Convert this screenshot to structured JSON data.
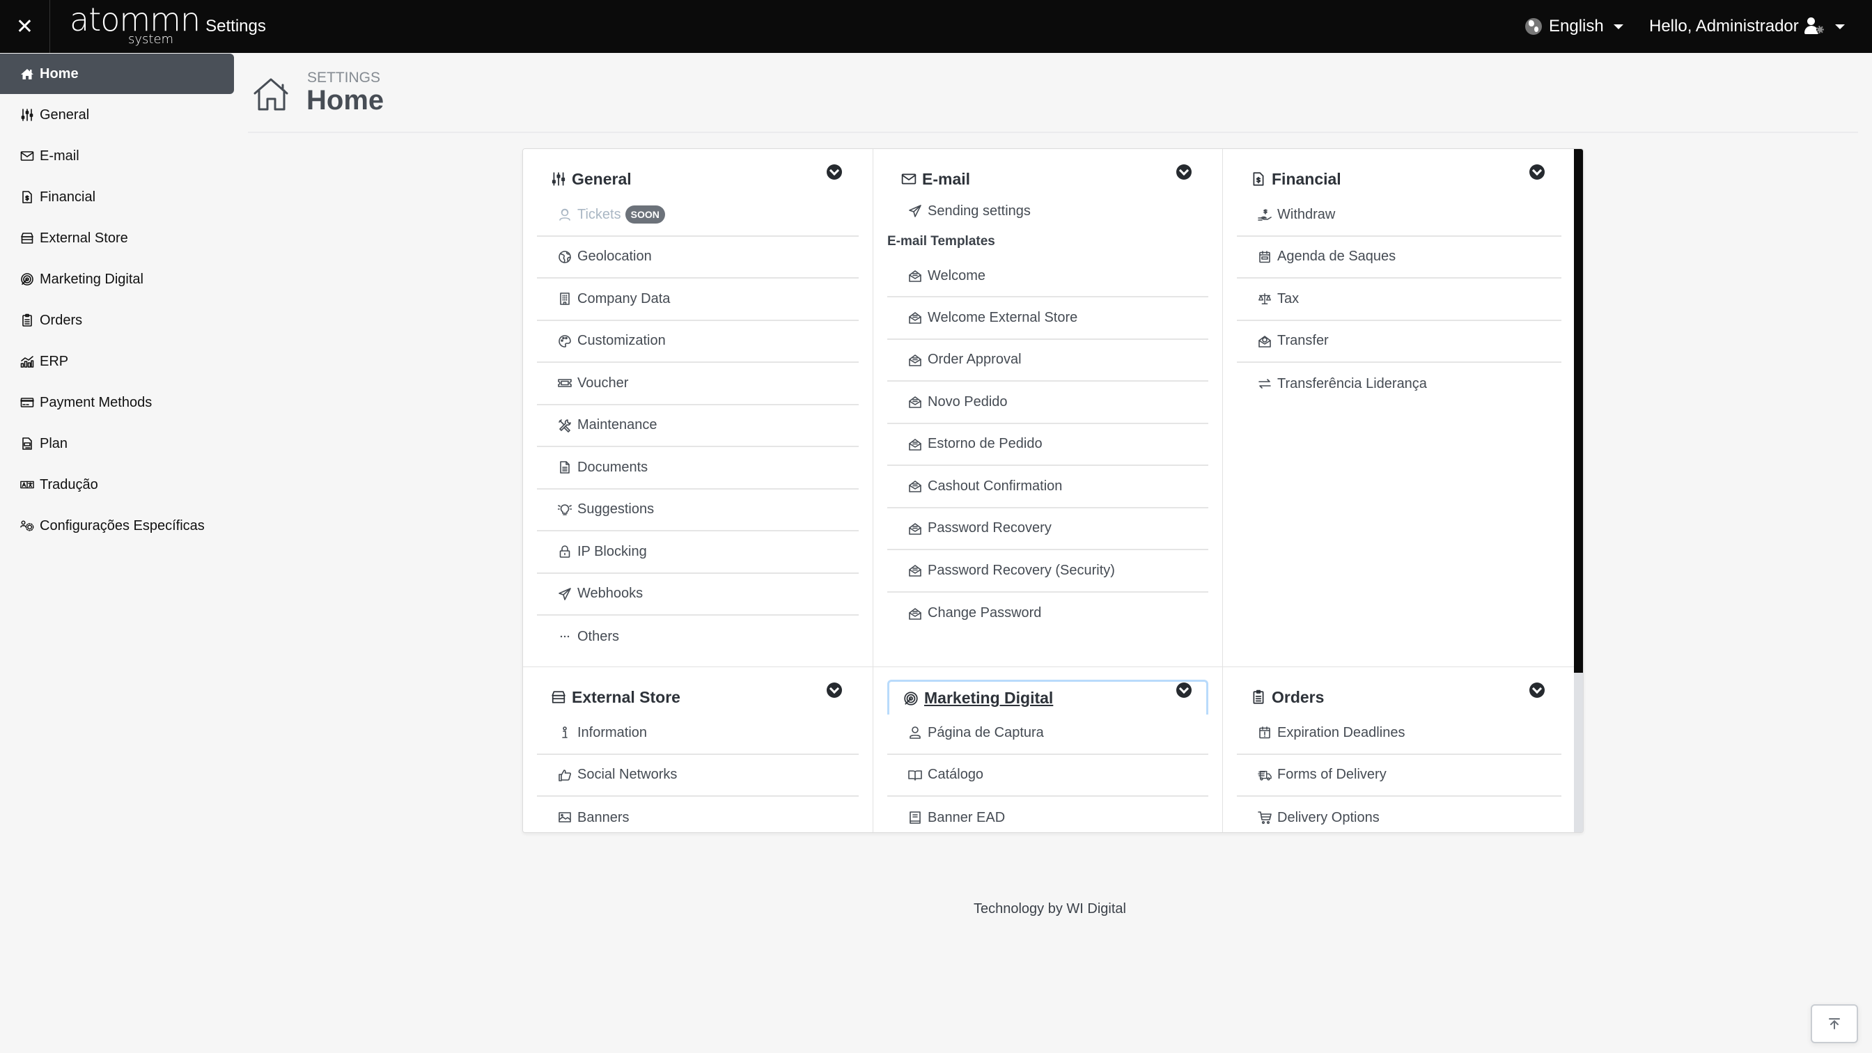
{
  "topbar": {
    "close_icon": "close-icon",
    "logo_main": "atommn",
    "logo_sub": "system",
    "app_title": "Settings",
    "language": {
      "label": "English",
      "icon": "globe-icon"
    },
    "user": {
      "greeting": "Hello, Administrador",
      "icon": "user-gear-icon"
    }
  },
  "sidebar": {
    "items": [
      {
        "label": "Home",
        "icon": "home-icon",
        "active": true
      },
      {
        "label": "General",
        "icon": "sliders-icon"
      },
      {
        "label": "E-mail",
        "icon": "envelope-icon"
      },
      {
        "label": "Financial",
        "icon": "invoice-dollar-icon"
      },
      {
        "label": "External Store",
        "icon": "storefront-icon"
      },
      {
        "label": "Marketing Digital",
        "icon": "target-click-icon"
      },
      {
        "label": "Orders",
        "icon": "clipboard-list-icon"
      },
      {
        "label": "ERP",
        "icon": "chart-growth-icon"
      },
      {
        "label": "Payment Methods",
        "icon": "credit-card-icon"
      },
      {
        "label": "Plan",
        "icon": "document-icon"
      },
      {
        "label": "Tradução",
        "icon": "translate-icon"
      },
      {
        "label": "Configurações Específicas",
        "icon": "users-gear-icon"
      }
    ]
  },
  "page": {
    "breadcrumb": "SETTINGS",
    "title": "Home",
    "icon": "home-outline-icon"
  },
  "cards": {
    "general": {
      "title": "General",
      "items": [
        {
          "label": "Tickets",
          "icon": "headset-icon",
          "badge": "SOON",
          "disabled": true
        },
        {
          "label": "Geolocation",
          "icon": "globe-icon"
        },
        {
          "label": "Company Data",
          "icon": "building-icon"
        },
        {
          "label": "Customization",
          "icon": "palette-icon"
        },
        {
          "label": "Voucher",
          "icon": "ticket-icon"
        },
        {
          "label": "Maintenance",
          "icon": "tools-icon"
        },
        {
          "label": "Documents",
          "icon": "file-text-icon"
        },
        {
          "label": "Suggestions",
          "icon": "lightbulb-icon"
        },
        {
          "label": "IP Blocking",
          "icon": "lock-icon"
        },
        {
          "label": "Webhooks",
          "icon": "send-icon"
        },
        {
          "label": "Others",
          "icon": "dots-icon"
        }
      ]
    },
    "email": {
      "title": "E-mail",
      "sending": {
        "label": "Sending settings",
        "icon": "send-icon"
      },
      "templates_heading": "E-mail Templates",
      "templates": [
        {
          "label": "Welcome"
        },
        {
          "label": "Welcome External Store"
        },
        {
          "label": "Order Approval"
        },
        {
          "label": "Novo Pedido"
        },
        {
          "label": "Estorno de Pedido"
        },
        {
          "label": "Cashout Confirmation"
        },
        {
          "label": "Password Recovery"
        },
        {
          "label": "Password Recovery (Security)"
        },
        {
          "label": "Change Password"
        }
      ],
      "template_icon": "envelope-open-icon"
    },
    "financial": {
      "title": "Financial",
      "items": [
        {
          "label": "Withdraw",
          "icon": "hand-dollar-icon"
        },
        {
          "label": "Agenda de Saques",
          "icon": "calendar-icon"
        },
        {
          "label": "Tax",
          "icon": "scale-icon"
        },
        {
          "label": "Transfer",
          "icon": "envelope-dollar-icon"
        },
        {
          "label": "Transferência Liderança",
          "icon": "arrows-exchange-icon"
        }
      ]
    },
    "external_store": {
      "title": "External Store",
      "items": [
        {
          "label": "Information",
          "icon": "info-icon"
        },
        {
          "label": "Social Networks",
          "icon": "thumbs-up-icon"
        },
        {
          "label": "Banners",
          "icon": "image-icon"
        }
      ]
    },
    "marketing": {
      "title": "Marketing Digital",
      "items": [
        {
          "label": "Página de Captura",
          "icon": "user-icon"
        },
        {
          "label": "Catálogo",
          "icon": "book-open-icon"
        },
        {
          "label": "Banner EAD",
          "icon": "book-icon"
        }
      ]
    },
    "orders": {
      "title": "Orders",
      "items": [
        {
          "label": "Expiration Deadlines",
          "icon": "calendar-alert-icon"
        },
        {
          "label": "Forms of Delivery",
          "icon": "truck-icon"
        },
        {
          "label": "Delivery Options",
          "icon": "cart-icon"
        }
      ]
    }
  },
  "footer": {
    "text": "Technology by WI Digital"
  },
  "back_to_top": {
    "icon": "arrow-to-top-icon"
  }
}
